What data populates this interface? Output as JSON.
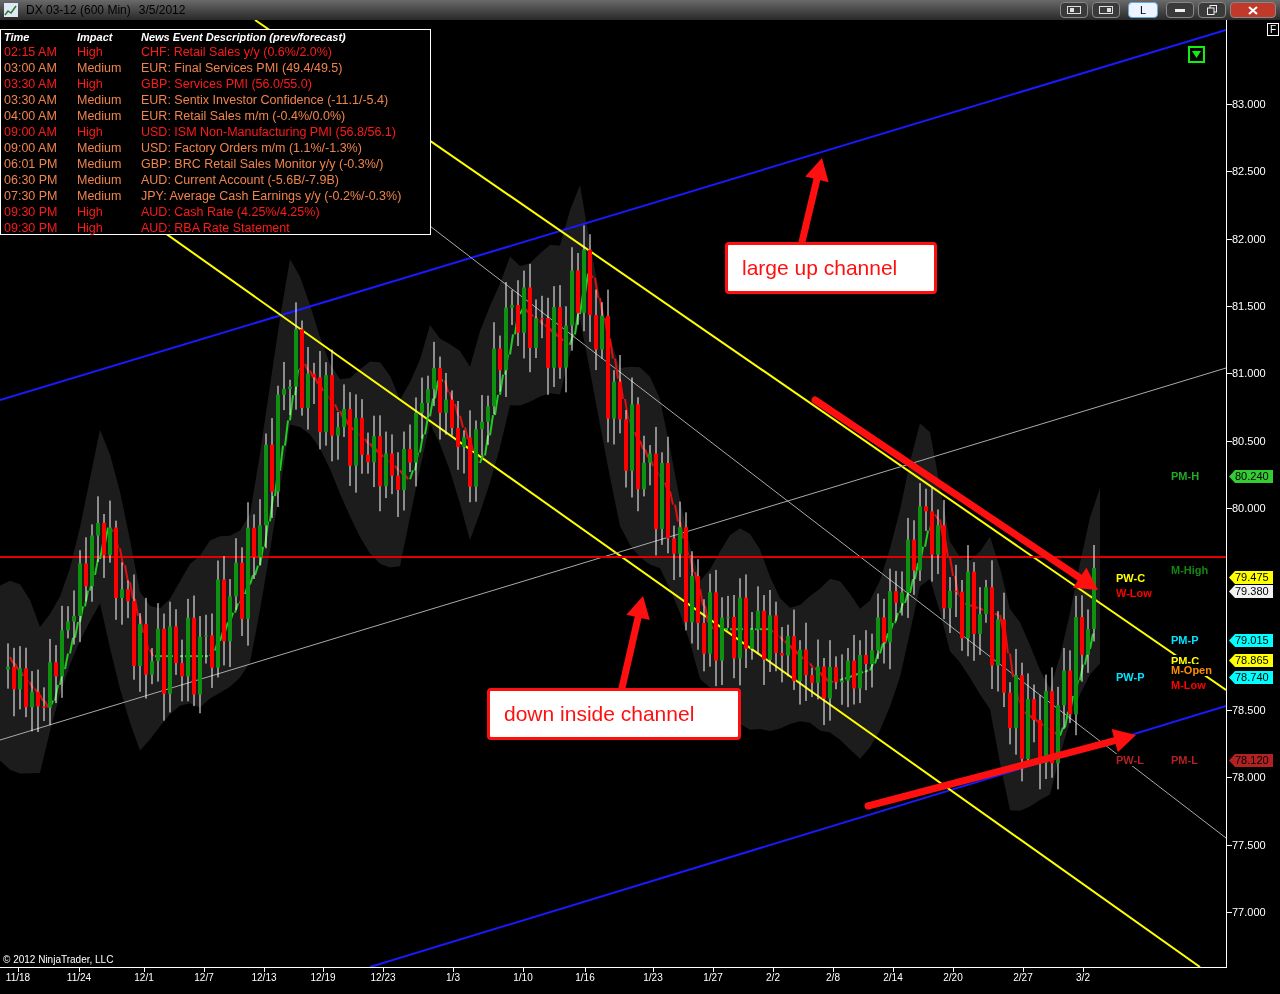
{
  "window": {
    "title": "DX 03-12 (600 Min)",
    "date": "3/5/2012",
    "mode_button": "L"
  },
  "news_table": {
    "columns": [
      "Time",
      "Impact",
      "News Event Description (prev/forecast)"
    ],
    "rows": [
      {
        "time": "02:15 AM",
        "impact": "High",
        "kind": "high",
        "description": "CHF: Retail Sales y/y (0.6%/2.0%)"
      },
      {
        "time": "03:00 AM",
        "impact": "Medium",
        "kind": "medium",
        "description": "EUR: Final Services PMI (49.4/49.5)"
      },
      {
        "time": "03:30 AM",
        "impact": "High",
        "kind": "high",
        "description": "GBP: Services PMI (56.0/55.0)"
      },
      {
        "time": "03:30 AM",
        "impact": "Medium",
        "kind": "medium",
        "description": "EUR: Sentix Investor Confidence (-11.1/-5.4)"
      },
      {
        "time": "04:00 AM",
        "impact": "Medium",
        "kind": "medium",
        "description": "EUR: Retail Sales m/m (-0.4%/0.0%)"
      },
      {
        "time": "09:00 AM",
        "impact": "High",
        "kind": "high",
        "description": "USD: ISM Non-Manufacturing PMI (56.8/56.1)"
      },
      {
        "time": "09:00 AM",
        "impact": "Medium",
        "kind": "medium",
        "description": "USD: Factory Orders m/m (1.1%/-1.3%)"
      },
      {
        "time": "06:01 PM",
        "impact": "Medium",
        "kind": "medium",
        "description": "GBP: BRC Retail Sales Monitor y/y (-0.3%/)"
      },
      {
        "time": "06:30 PM",
        "impact": "Medium",
        "kind": "medium",
        "description": "AUD: Current Account (-5.6B/-7.9B)"
      },
      {
        "time": "07:30 PM",
        "impact": "Medium",
        "kind": "medium",
        "description": "JPY: Average Cash Earnings y/y (-0.2%/-0.3%)"
      },
      {
        "time": "09:30 PM",
        "impact": "High",
        "kind": "high",
        "description": "AUD: Cash Rate (4.25%/4.25%)"
      },
      {
        "time": "09:30 PM",
        "impact": "High",
        "kind": "high",
        "description": "AUD: RBA Rate Statement"
      }
    ]
  },
  "annotations": [
    "large up channel",
    "down inside channel"
  ],
  "level_labels": [
    {
      "text": "PM-H",
      "color": "#22aa22"
    },
    {
      "text": "M-High",
      "color": "#118811"
    },
    {
      "text": "PW-C",
      "color": "#ffff00"
    },
    {
      "text": "W-Low",
      "color": "#ff0000"
    },
    {
      "text": "PM-P",
      "color": "#00e5ff"
    },
    {
      "text": "PM-C",
      "color": "#ffff00"
    },
    {
      "text": "M-Open",
      "color": "#ff8c00"
    },
    {
      "text": "PW-P",
      "color": "#00e5ff"
    },
    {
      "text": "M-Low",
      "color": "#ff0000"
    },
    {
      "text": "PW-L",
      "color": "#b22222"
    },
    {
      "text": "PM-L",
      "color": "#b22222"
    }
  ],
  "price_axis": [
    "83.000",
    "82.500",
    "82.000",
    "81.500",
    "81.000",
    "80.500",
    "80.000",
    "78.500",
    "78.000",
    "77.500",
    "77.000"
  ],
  "price_tags": [
    {
      "text": "80.240",
      "color": "#33cc33"
    },
    {
      "text": "79.475",
      "color": "#ffff00"
    },
    {
      "text": "79.380",
      "color": "#f2f2f2"
    },
    {
      "text": "79.015",
      "color": "#00ffff"
    },
    {
      "text": "78.865",
      "color": "#ffff00"
    },
    {
      "text": "78.740",
      "color": "#00ffff"
    },
    {
      "text": "78.120",
      "color": "#b22222"
    }
  ],
  "date_axis": [
    "11/18",
    "11/24",
    "12/1",
    "12/7",
    "12/13",
    "12/19",
    "12/23",
    "1/3",
    "1/10",
    "1/16",
    "1/23",
    "1/27",
    "2/2",
    "2/8",
    "2/14",
    "2/20",
    "2/27",
    "3/2"
  ],
  "copyright": "© 2012 NinjaTrader, LLC",
  "axis_mode_button": "F"
}
